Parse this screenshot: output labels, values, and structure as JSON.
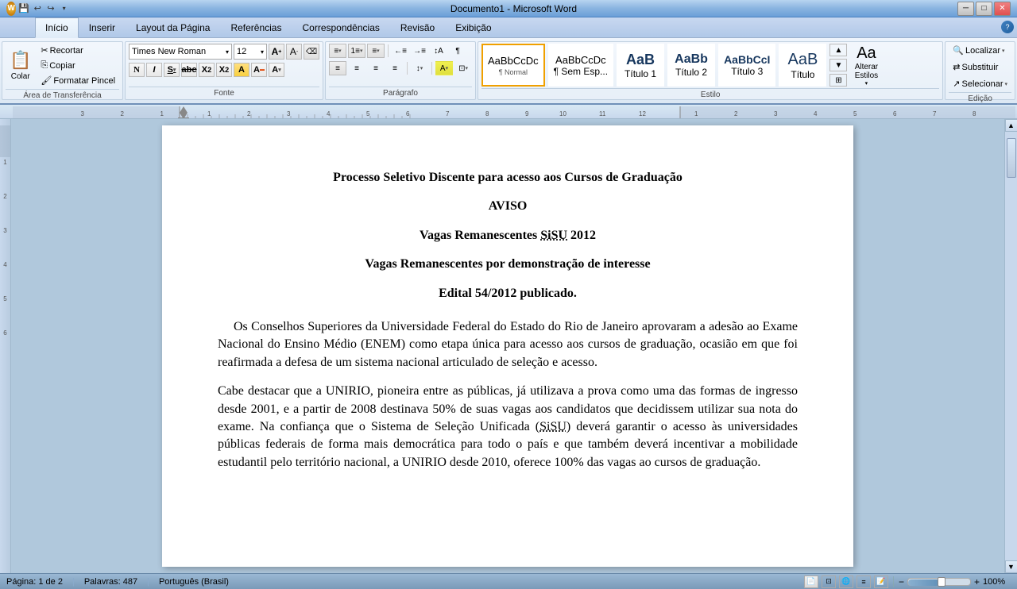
{
  "titlebar": {
    "title": "Documento1 - Microsoft Word",
    "minimize": "─",
    "maximize": "□",
    "close": "✕"
  },
  "quickaccess": {
    "save": "💾",
    "undo": "↩",
    "redo": "↪",
    "dropdown": "▾"
  },
  "ribbon": {
    "tabs": [
      {
        "label": "Início",
        "active": true
      },
      {
        "label": "Inserir",
        "active": false
      },
      {
        "label": "Layout da Página",
        "active": false
      },
      {
        "label": "Referências",
        "active": false
      },
      {
        "label": "Correspondências",
        "active": false
      },
      {
        "label": "Revisão",
        "active": false
      },
      {
        "label": "Exibição",
        "active": false
      }
    ],
    "groups": {
      "clipboard": {
        "label": "Área de Transferência",
        "paste": "Colar",
        "cut": "Recortar",
        "copy": "Copiar",
        "format_painter": "Formatar Pincel"
      },
      "font": {
        "label": "Fonte",
        "font_name": "Times New Roman",
        "font_size": "12",
        "bold": "N",
        "italic": "I",
        "underline": "S",
        "strikethrough": "abc",
        "subscript": "X₂",
        "superscript": "X²",
        "font_color": "A"
      },
      "paragraph": {
        "label": "Parágrafo"
      },
      "styles": {
        "label": "Estilo",
        "items": [
          {
            "preview": "AaBbCcDc",
            "label": "¶ Normal",
            "active": true
          },
          {
            "preview": "AaBbCcDc",
            "label": "¶ Sem Esp...",
            "active": false
          },
          {
            "preview": "AaB",
            "label": "Título 1",
            "active": false,
            "large": true
          },
          {
            "preview": "AaBb",
            "label": "Título 2",
            "active": false
          },
          {
            "preview": "AaBbCcI",
            "label": "Título 3",
            "active": false
          },
          {
            "preview": "AaB",
            "label": "Título",
            "active": false,
            "large": true
          }
        ],
        "alterar": "Alterar\nEstilos"
      },
      "editing": {
        "label": "Edição",
        "find": "Localizar",
        "replace": "Substituir",
        "select": "Selecionar"
      }
    }
  },
  "document": {
    "title1": "Processo Seletivo Discente para acesso aos Cursos de Graduação",
    "title2": "AVISO",
    "title3": "Vagas Remanescentes SiSU 2012",
    "title4": "Vagas Remanescentes por demonstração de interesse",
    "title5": "Edital 54/2012 publicado.",
    "para1": "Os Conselhos Superiores da Universidade Federal do Estado do Rio de Janeiro aprovaram a adesão ao Exame Nacional do Ensino Médio (ENEM) como etapa única para acesso aos cursos de graduação, ocasião em que foi reafirmada a defesa de um sistema nacional articulado de seleção e acesso.",
    "para2": "Cabe destacar que a UNIRIO, pioneira entre as públicas, já utilizava a prova como uma das formas de ingresso desde 2001, e a partir de 2008 destinava 50% de suas vagas aos candidatos que decidissem utilizar sua nota do exame. Na confiança que o Sistema de Seleção Unificada (SiSU) deverá garantir o acesso às universidades públicas federais de forma mais democrática para todo o país e que também deverá incentivar a mobilidade estudantil pelo território nacional, a UNIRIO desde 2010, oferece 100% das vagas ao cursos de graduação."
  },
  "statusbar": {
    "page": "Página: 1 de 2",
    "words": "Palavras: 487",
    "language": "Português (Brasil)"
  }
}
